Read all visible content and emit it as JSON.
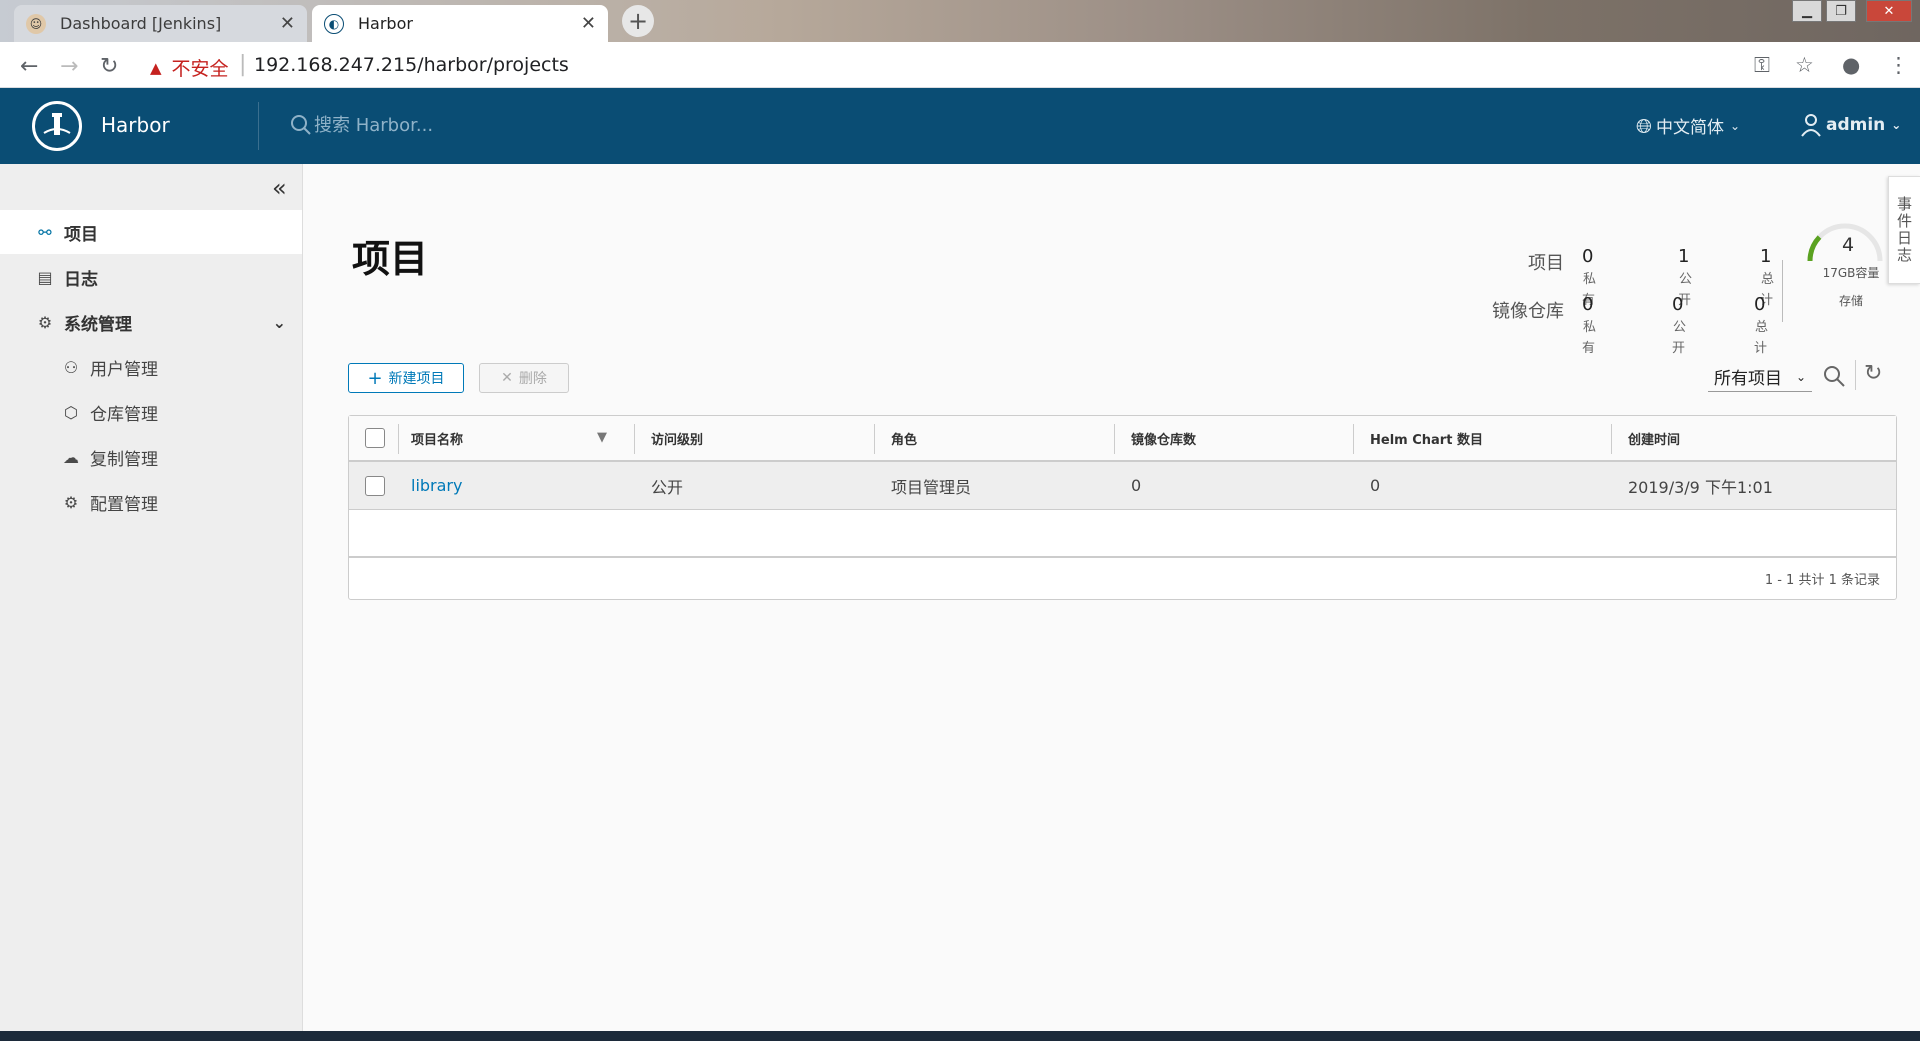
{
  "browser": {
    "tabs": [
      {
        "title": "Dashboard [Jenkins]",
        "active": false
      },
      {
        "title": "Harbor",
        "active": true
      }
    ],
    "security_label": "不安全",
    "url": "192.168.247.215/harbor/projects"
  },
  "header": {
    "brand": "Harbor",
    "search_placeholder": "搜索 Harbor...",
    "language": "中文简体",
    "user": "admin"
  },
  "sidebar": {
    "items": [
      {
        "label": "项目",
        "icon": "projects-icon",
        "active": true
      },
      {
        "label": "日志",
        "icon": "logs-icon"
      },
      {
        "label": "系统管理",
        "icon": "admin-icon",
        "expanded": true
      }
    ],
    "subitems": [
      {
        "label": "用户管理",
        "icon": "users-icon"
      },
      {
        "label": "仓库管理",
        "icon": "registry-icon"
      },
      {
        "label": "复制管理",
        "icon": "replication-icon"
      },
      {
        "label": "配置管理",
        "icon": "config-icon"
      }
    ]
  },
  "main": {
    "title": "项目",
    "stats": {
      "projects_label": "项目",
      "repos_label": "镜像仓库",
      "projects": {
        "private": "0",
        "public": "1",
        "total": "1"
      },
      "repos": {
        "private": "0",
        "public": "0",
        "total": "0"
      },
      "private_suffix": "私有",
      "public_suffix": "公开",
      "total_suffix": "总计"
    },
    "storage": {
      "value": "4",
      "capacity": "17GB容量",
      "caption": "存储",
      "used_fraction": 0.24
    },
    "side_tab": "事件日志",
    "buttons": {
      "new_project": "新建项目",
      "delete": "删除"
    },
    "filter_label": "所有项目",
    "grid": {
      "columns": [
        "项目名称",
        "访问级别",
        "角色",
        "镜像仓库数",
        "Helm Chart 数目",
        "创建时间"
      ],
      "rows": [
        {
          "name": "library",
          "access": "公开",
          "role": "项目管理员",
          "repos": "0",
          "charts": "0",
          "created": "2019/3/9 下午1:01"
        }
      ],
      "footer": "1 - 1 共计 1 条记录"
    }
  },
  "colors": {
    "header_bg": "#0a4d74",
    "accent": "#0079b8",
    "gauge": "#5aa220"
  }
}
